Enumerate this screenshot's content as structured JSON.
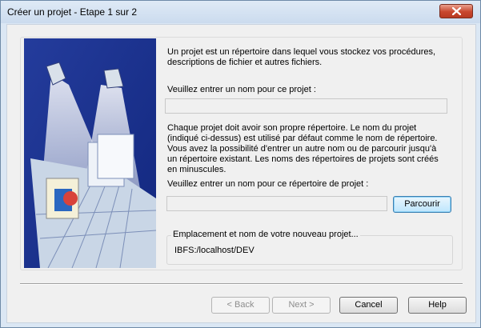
{
  "window": {
    "title": "Créer un projet - Etape 1 sur 2"
  },
  "intro_text": "Un projet est un répertoire dans lequel vous stockez vos procédures, descriptions de fichier et autres fichiers.",
  "project_name": {
    "label": "Veuillez entrer un nom pour ce projet :",
    "value": ""
  },
  "info_text": "Chaque projet doit avoir son propre répertoire. Le nom du projet (indiqué ci-dessus) est utilisé par défaut comme le nom de répertoire. Vous avez la possibilité d'entrer un autre nom ou de parcourir jusqu'à un répertoire existant. Les noms des répertoires de projets sont créés en minuscules.",
  "directory_name": {
    "label": "Veuillez entrer un nom pour ce répertoire de projet :",
    "value": "",
    "browse_label": "Parcourir"
  },
  "location": {
    "legend": "Emplacement et nom de votre nouveau projet...",
    "value": "IBFS:/localhost/DEV"
  },
  "buttons": {
    "back": "< Back",
    "next": "Next >",
    "cancel": "Cancel",
    "help": "Help"
  },
  "colors": {
    "illustration_bg": "#1f3ea8",
    "title_bar": "#dbe7f4",
    "dialog_bg": "#f0f0f0"
  }
}
